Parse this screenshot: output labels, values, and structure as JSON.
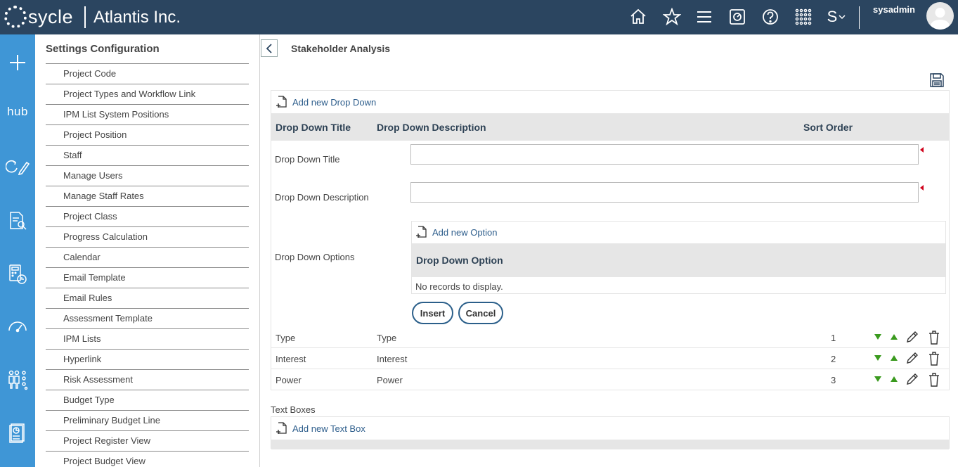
{
  "brand": {
    "logo_text": "sycle",
    "company": "Atlantis Inc."
  },
  "topbar": {
    "icons": [
      "home-icon",
      "star-icon",
      "menu-icon",
      "help-desk-icon",
      "help-icon",
      "apps-grid-icon",
      "sycle-switch-icon"
    ],
    "switch_label": "S",
    "username": "sysadmin"
  },
  "rail": {
    "hub_label": "hub"
  },
  "settings": {
    "title": "Settings Configuration",
    "items": [
      "Project Code",
      "Project Types and Workflow Link",
      "IPM List System Positions",
      "Project Position",
      "Staff",
      "Manage Users",
      "Manage Staff Rates",
      "Project Class",
      "Progress Calculation",
      "Calendar",
      "Email Template",
      "Email Rules",
      "Assessment Template",
      "IPM Lists",
      "Hyperlink",
      "Risk Assessment",
      "Budget Type",
      "Preliminary Budget Line",
      "Project Register View",
      "Project Budget View"
    ]
  },
  "page": {
    "title": "Stakeholder Analysis"
  },
  "dropdowns": {
    "add_label": "Add new Drop Down",
    "columns": {
      "title": "Drop Down Title",
      "description": "Drop Down Description",
      "sort": "Sort Order"
    },
    "form": {
      "title_label": "Drop Down Title",
      "title_value": "",
      "description_label": "Drop Down Description",
      "description_value": "",
      "options_label": "Drop Down Options",
      "options": {
        "add_label": "Add new Option",
        "column": "Drop Down Option",
        "empty": "No records to display."
      },
      "insert_label": "Insert",
      "cancel_label": "Cancel"
    },
    "rows": [
      {
        "title": "Type",
        "description": "Type",
        "sort": "1"
      },
      {
        "title": "Interest",
        "description": "Interest",
        "sort": "2"
      },
      {
        "title": "Power",
        "description": "Power",
        "sort": "3"
      }
    ]
  },
  "textboxes": {
    "section_label": "Text Boxes",
    "add_label": "Add new Text Box"
  },
  "colors": {
    "topbar": "#2b4560",
    "rail": "#3f96d6",
    "link": "#2e5e8c",
    "arrow_green": "#3a9a1e",
    "required": "#d0021b"
  }
}
